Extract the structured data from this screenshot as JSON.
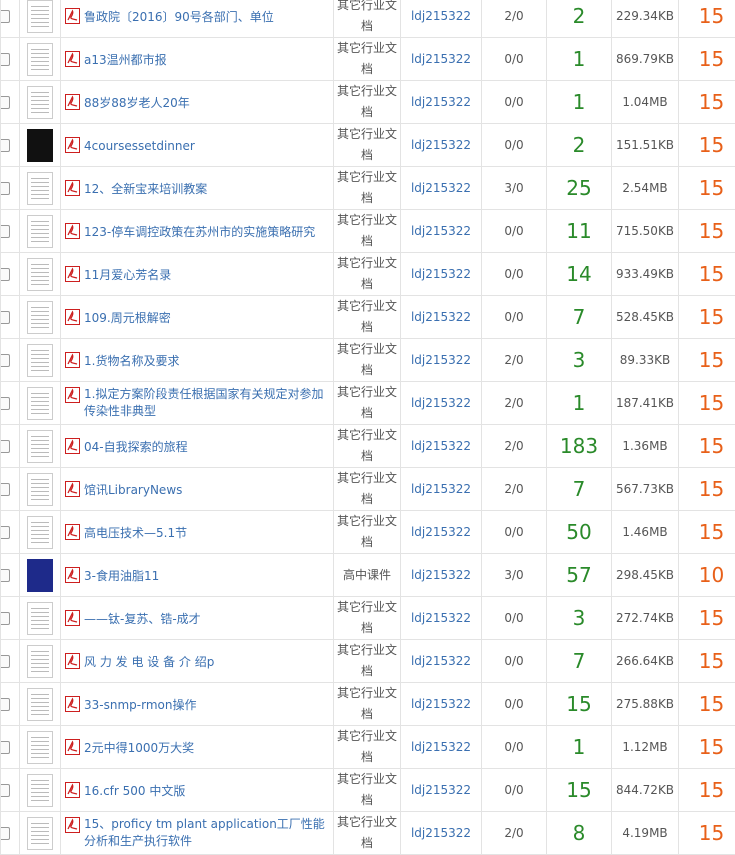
{
  "rows": [
    {
      "title": "鲁政院〔2016〕90号各部门、单位",
      "category": "其它行业文档",
      "user": "ldj215322",
      "ratio": "2/0",
      "pages": "2",
      "size": "229.34KB",
      "price": "15",
      "thumb": "doc"
    },
    {
      "title": "a13温州都市报",
      "category": "其它行业文档",
      "user": "ldj215322",
      "ratio": "0/0",
      "pages": "1",
      "size": "869.79KB",
      "price": "15",
      "thumb": "doc"
    },
    {
      "title": "88岁88岁老人20年",
      "category": "其它行业文档",
      "user": "ldj215322",
      "ratio": "0/0",
      "pages": "1",
      "size": "1.04MB",
      "price": "15",
      "thumb": "doc"
    },
    {
      "title": "4coursessetdinner",
      "category": "其它行业文档",
      "user": "ldj215322",
      "ratio": "0/0",
      "pages": "2",
      "size": "151.51KB",
      "price": "15",
      "thumb": "dark"
    },
    {
      "title": "12、全新宝来培训教案",
      "category": "其它行业文档",
      "user": "ldj215322",
      "ratio": "3/0",
      "pages": "25",
      "size": "2.54MB",
      "price": "15",
      "thumb": "doc"
    },
    {
      "title": "123-停车调控政策在苏州市的实施策略研究",
      "category": "其它行业文档",
      "user": "ldj215322",
      "ratio": "0/0",
      "pages": "11",
      "size": "715.50KB",
      "price": "15",
      "thumb": "doc"
    },
    {
      "title": "11月爱心芳名录",
      "category": "其它行业文档",
      "user": "ldj215322",
      "ratio": "0/0",
      "pages": "14",
      "size": "933.49KB",
      "price": "15",
      "thumb": "doc"
    },
    {
      "title": "109.周元根解密",
      "category": "其它行业文档",
      "user": "ldj215322",
      "ratio": "0/0",
      "pages": "7",
      "size": "528.45KB",
      "price": "15",
      "thumb": "doc"
    },
    {
      "title": "1.货物名称及要求",
      "category": "其它行业文档",
      "user": "ldj215322",
      "ratio": "2/0",
      "pages": "3",
      "size": "89.33KB",
      "price": "15",
      "thumb": "doc"
    },
    {
      "title": "1.拟定方案阶段责任根据国家有关规定对参加传染性非典型",
      "category": "其它行业文档",
      "user": "ldj215322",
      "ratio": "2/0",
      "pages": "1",
      "size": "187.41KB",
      "price": "15",
      "thumb": "doc"
    },
    {
      "title": "04-自我探索的旅程",
      "category": "其它行业文档",
      "user": "ldj215322",
      "ratio": "2/0",
      "pages": "183",
      "size": "1.36MB",
      "price": "15",
      "thumb": "doc"
    },
    {
      "title": "馆讯LibraryNews",
      "category": "其它行业文档",
      "user": "ldj215322",
      "ratio": "2/0",
      "pages": "7",
      "size": "567.73KB",
      "price": "15",
      "thumb": "doc"
    },
    {
      "title": "高电压技术—5.1节",
      "category": "其它行业文档",
      "user": "ldj215322",
      "ratio": "0/0",
      "pages": "50",
      "size": "1.46MB",
      "price": "15",
      "thumb": "doc"
    },
    {
      "title": "3-食用油脂11",
      "category": "高中课件",
      "user": "ldj215322",
      "ratio": "3/0",
      "pages": "57",
      "size": "298.45KB",
      "price": "10",
      "thumb": "blue"
    },
    {
      "title": "——钛-复苏、锆-成才",
      "category": "其它行业文档",
      "user": "ldj215322",
      "ratio": "0/0",
      "pages": "3",
      "size": "272.74KB",
      "price": "15",
      "thumb": "doc"
    },
    {
      "title": "风 力 发 电 设 备 介 绍p",
      "category": "其它行业文档",
      "user": "ldj215322",
      "ratio": "0/0",
      "pages": "7",
      "size": "266.64KB",
      "price": "15",
      "thumb": "doc"
    },
    {
      "title": "33-snmp-rmon操作",
      "category": "其它行业文档",
      "user": "ldj215322",
      "ratio": "0/0",
      "pages": "15",
      "size": "275.88KB",
      "price": "15",
      "thumb": "doc"
    },
    {
      "title": "2元中得1000万大奖",
      "category": "其它行业文档",
      "user": "ldj215322",
      "ratio": "0/0",
      "pages": "1",
      "size": "1.12MB",
      "price": "15",
      "thumb": "doc"
    },
    {
      "title": "16.cfr 500 中文版",
      "category": "其它行业文档",
      "user": "ldj215322",
      "ratio": "0/0",
      "pages": "15",
      "size": "844.72KB",
      "price": "15",
      "thumb": "doc"
    },
    {
      "title": "15、proficy tm plant application工厂性能分析和生产执行软件",
      "category": "其它行业文档",
      "user": "ldj215322",
      "ratio": "2/0",
      "pages": "8",
      "size": "4.19MB",
      "price": "15",
      "thumb": "doc"
    }
  ],
  "colors": {
    "title_link": "#3a6fb0",
    "pages": "#2a8a2a",
    "price": "#e86019",
    "pdf_icon": "#cc1f1f"
  }
}
